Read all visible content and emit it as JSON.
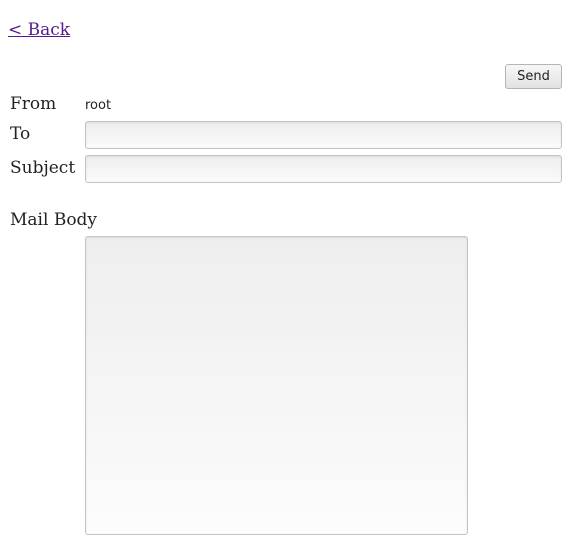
{
  "nav": {
    "back_label": "< Back"
  },
  "toolbar": {
    "send_label": "Send"
  },
  "form": {
    "from_label": "From",
    "from_value": "root",
    "to_label": "To",
    "to_value": "",
    "to_placeholder": "",
    "subject_label": "Subject",
    "subject_value": "",
    "subject_placeholder": "",
    "body_label": "Mail Body",
    "body_value": ""
  }
}
